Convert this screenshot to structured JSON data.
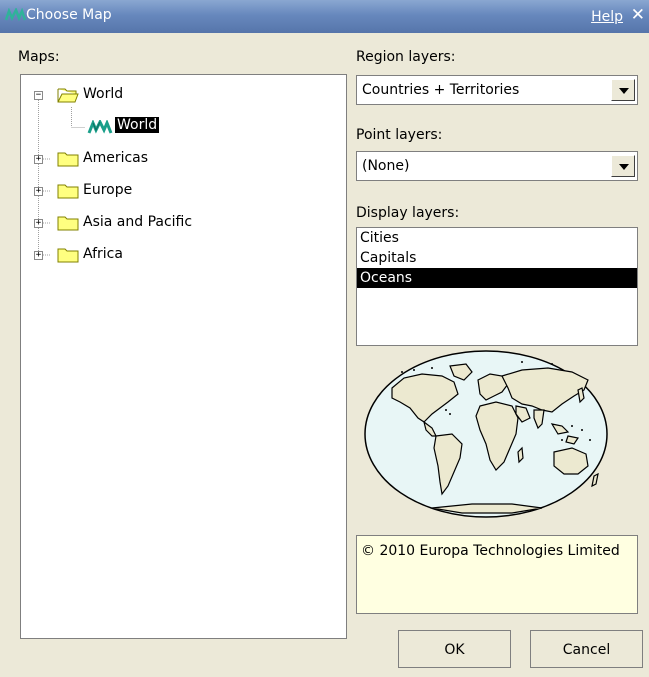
{
  "window": {
    "title": "Choose Map",
    "help_label": "Help",
    "close_glyph": "✕"
  },
  "maps": {
    "label": "Maps:",
    "tree": [
      {
        "label": "World",
        "expanded": true,
        "children": [
          {
            "label": "World",
            "selected": true
          }
        ]
      },
      {
        "label": "Americas",
        "expanded": false
      },
      {
        "label": "Europe",
        "expanded": false
      },
      {
        "label": "Asia and Pacific",
        "expanded": false
      },
      {
        "label": "Africa",
        "expanded": false
      }
    ]
  },
  "region_layers": {
    "label": "Region layers:",
    "value": "Countries + Territories"
  },
  "point_layers": {
    "label": "Point layers:",
    "value": "(None)"
  },
  "display_layers": {
    "label": "Display layers:",
    "items": [
      {
        "label": "Cities",
        "selected": false
      },
      {
        "label": "Capitals",
        "selected": false
      },
      {
        "label": "Oceans",
        "selected": true
      }
    ]
  },
  "copyright": "© 2010 Europa Technologies Limited",
  "buttons": {
    "ok": "OK",
    "cancel": "Cancel"
  },
  "colors": {
    "title_bar": "#6a8bc0",
    "dialog_bg": "#ece9d8",
    "folder": "#ffff80",
    "ocean": "#e8f6f6",
    "land": "#ece9d0",
    "info_bg": "#ffffe1",
    "selection": "#000000"
  }
}
